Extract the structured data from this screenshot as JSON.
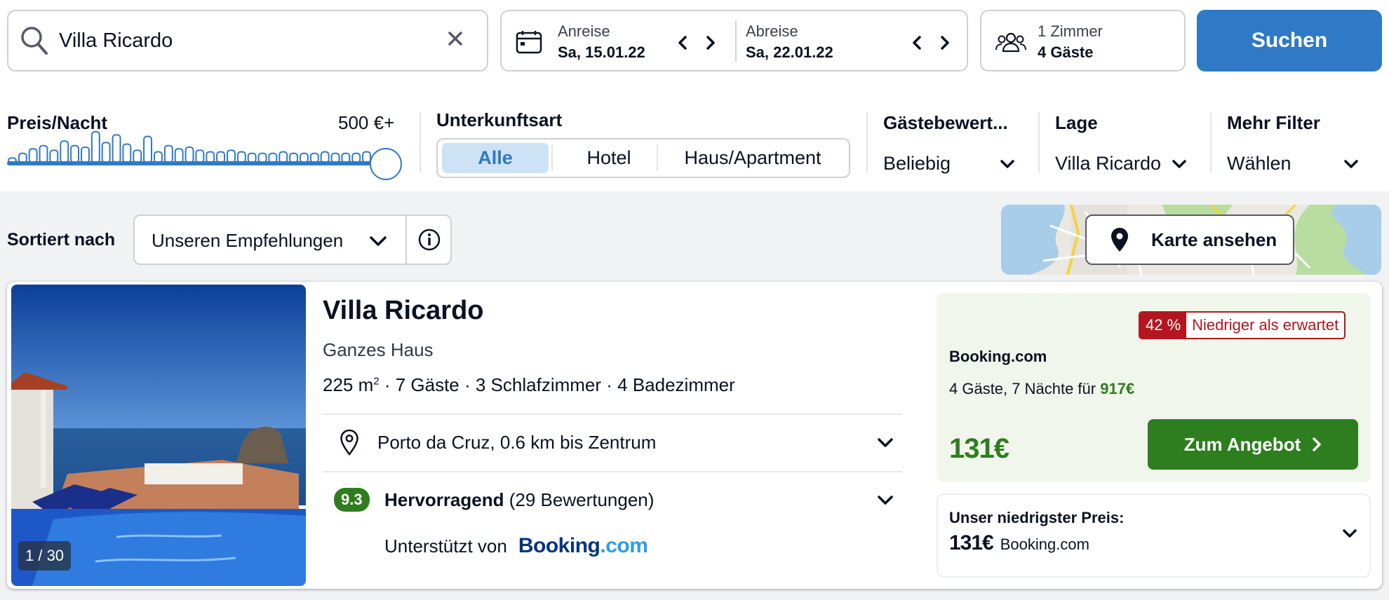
{
  "search": {
    "query": "Villa Ricardo"
  },
  "dates": {
    "checkin_label": "Anreise",
    "checkin_value": "Sa, 15.01.22",
    "checkout_label": "Abreise",
    "checkout_value": "Sa, 22.01.22"
  },
  "guests": {
    "rooms": "1 Zimmer",
    "guests": "4 Gäste"
  },
  "search_button": "Suchen",
  "filters": {
    "price_label": "Preis/Nacht",
    "price_max": "500 €+",
    "price_slider_value": 1.0,
    "histogram": [
      0.15,
      0.3,
      0.45,
      0.55,
      0.4,
      0.7,
      0.55,
      0.5,
      1.0,
      0.65,
      0.9,
      0.6,
      0.4,
      0.85,
      0.35,
      0.55,
      0.45,
      0.5,
      0.4,
      0.35,
      0.35,
      0.4,
      0.35,
      0.3,
      0.3,
      0.3,
      0.35,
      0.3,
      0.3,
      0.3,
      0.35,
      0.3,
      0.3,
      0.3,
      0.35
    ],
    "type_label": "Unterkunftsart",
    "type_options": [
      "Alle",
      "Hotel",
      "Haus/Apartment"
    ],
    "type_selected": "Alle",
    "rating_label": "Gästebewert...",
    "rating_value": "Beliebig",
    "location_label": "Lage",
    "location_value": "Villa Ricardo",
    "more_label": "Mehr Filter",
    "more_value": "Wählen"
  },
  "sort": {
    "label": "Sortiert nach",
    "value": "Unseren Empfehlungen"
  },
  "map_button": "Karte ansehen",
  "listing": {
    "name": "Villa Ricardo",
    "type": "Ganzes Haus",
    "area": "225 m",
    "area_sup": "2",
    "details": " · 7 Gäste · 3 Schlafzimmer · 4 Badezimmer",
    "location": "Porto da Cruz, 0.6 km bis Zentrum",
    "rating": "9.3",
    "rating_text": "Hervorragend",
    "reviews": "(29 Bewertungen)",
    "supported_by": "Unterstützt von",
    "photo_counter": "1 / 30",
    "booking_logo_a": "Booking",
    "booking_logo_b": ".com"
  },
  "offer": {
    "badge_percent": "42 %",
    "badge_text": "Niedriger als erwartet",
    "provider": "Booking.com",
    "stay_text": "4 Gäste, 7 Nächte für ",
    "stay_total": "917€",
    "price": "131€",
    "cta": "Zum Angebot"
  },
  "lowest": {
    "label": "Unser niedrigster Preis:",
    "price": "131€",
    "provider": "Booking.com"
  },
  "colors": {
    "accent": "#2f79c7",
    "green": "#2e7d1f",
    "red": "#b3161e"
  }
}
